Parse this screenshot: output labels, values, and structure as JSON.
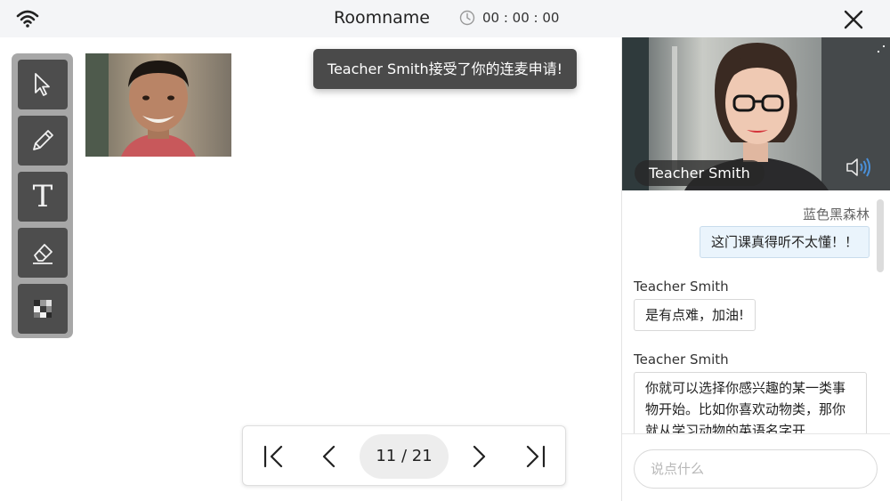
{
  "header": {
    "room_name": "Roomname",
    "timer": "00 : 00 : 00"
  },
  "icons": {
    "wifi": "wifi-icon",
    "clock": "clock-icon",
    "close": "close-icon",
    "speaker": "speaker-icon"
  },
  "toolbar": {
    "tools": [
      "select",
      "pencil",
      "text",
      "eraser",
      "mosaic"
    ],
    "text_tool_glyph": "T"
  },
  "toast": {
    "message": "Teacher Smith接受了你的连麦申请!"
  },
  "teacher_video": {
    "name": "Teacher Smith"
  },
  "chat": {
    "messages": [
      {
        "sender": "蓝色黑森林",
        "text": "这门课真得听不太懂！！",
        "self": true
      },
      {
        "sender": "Teacher Smith",
        "text": "是有点难，加油!",
        "self": false
      },
      {
        "sender": "Teacher Smith",
        "text": "你就可以选择你感兴趣的某一类事物开始。比如你喜欢动物类，那你就从学习动物的英语名字开",
        "self": false
      }
    ],
    "input_placeholder": "说点什么"
  },
  "pager": {
    "page_indicator": "11 / 21"
  },
  "colors": {
    "topbar_bg": "#f4f5f7",
    "toolbar_bg": "#a7a7a7",
    "tool_bg": "#4d4d4d",
    "toast_bg": "#4a4a4a",
    "self_bubble_bg": "#eaf4fc",
    "speaker_accent": "#4a90d9"
  }
}
